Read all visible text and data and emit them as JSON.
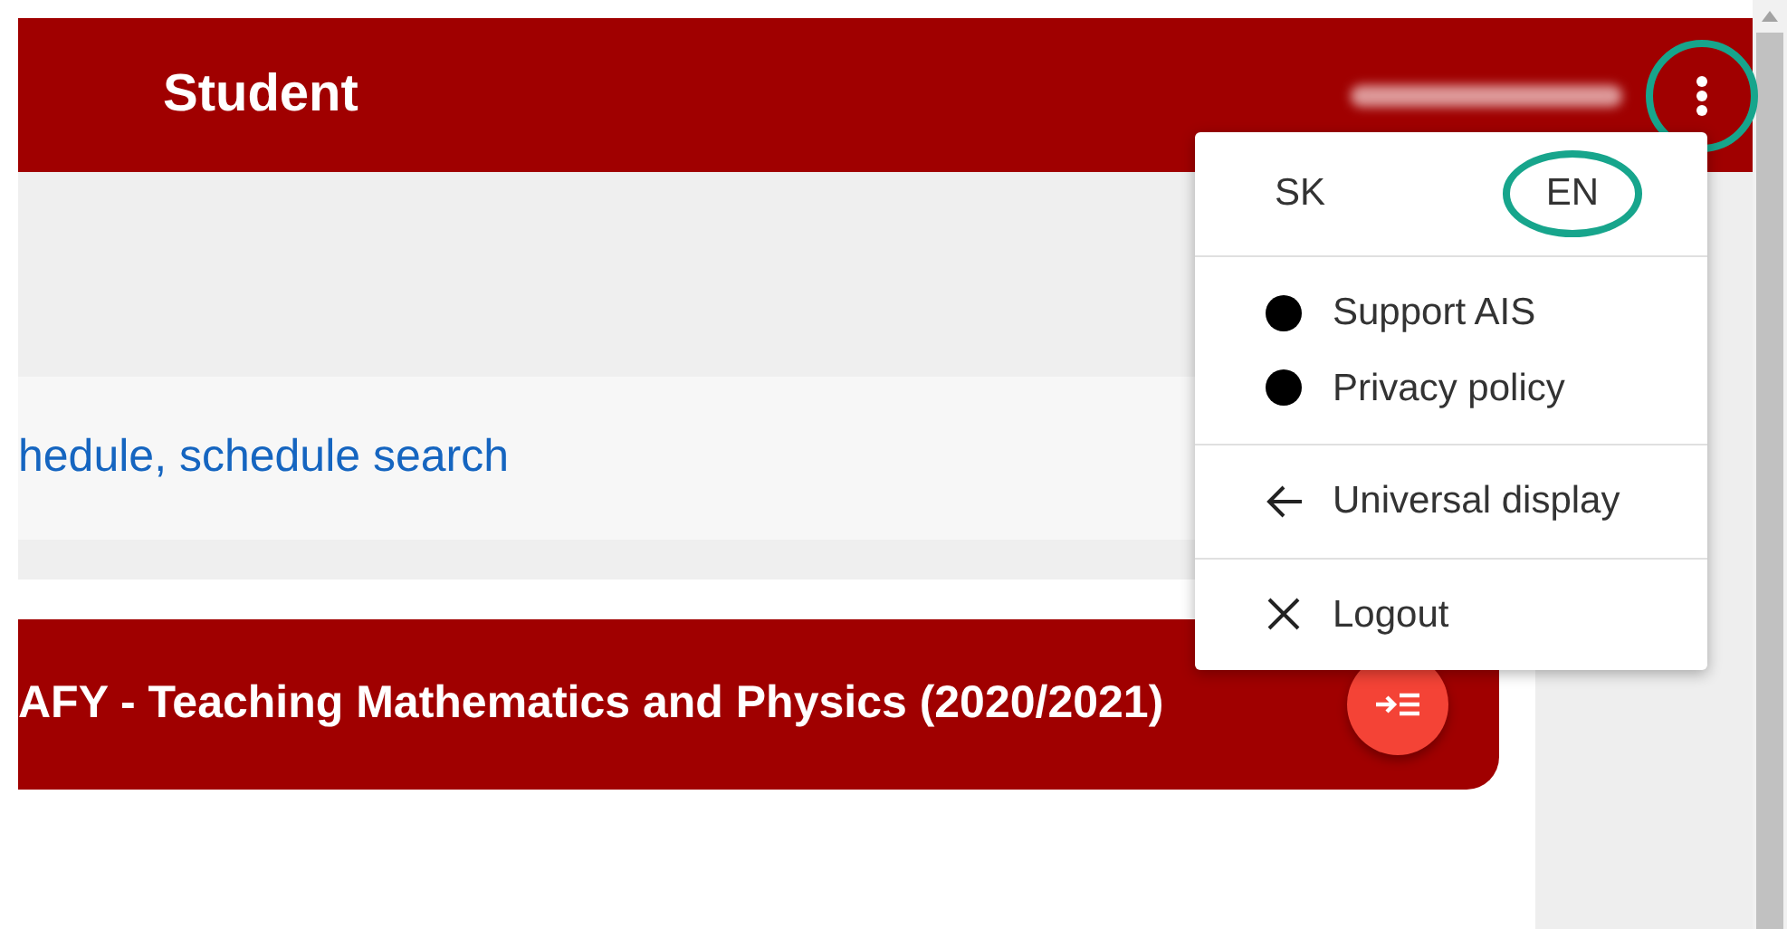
{
  "header": {
    "title": "Student",
    "menu_button": {
      "highlighted": true
    }
  },
  "content": {
    "link": "hedule, schedule search",
    "study_bar": {
      "title": "AFY - Teaching Mathematics and Physics (2020/2021)"
    }
  },
  "menu": {
    "languages": [
      {
        "label": "SK",
        "highlighted": false
      },
      {
        "label": "EN",
        "highlighted": true
      }
    ],
    "groups": [
      [
        {
          "kind": "dot",
          "label": "Support AIS"
        },
        {
          "kind": "dot",
          "label": "Privacy policy"
        }
      ],
      [
        {
          "kind": "back",
          "label": "Universal display"
        }
      ],
      [
        {
          "kind": "close",
          "label": "Logout"
        }
      ]
    ]
  }
}
